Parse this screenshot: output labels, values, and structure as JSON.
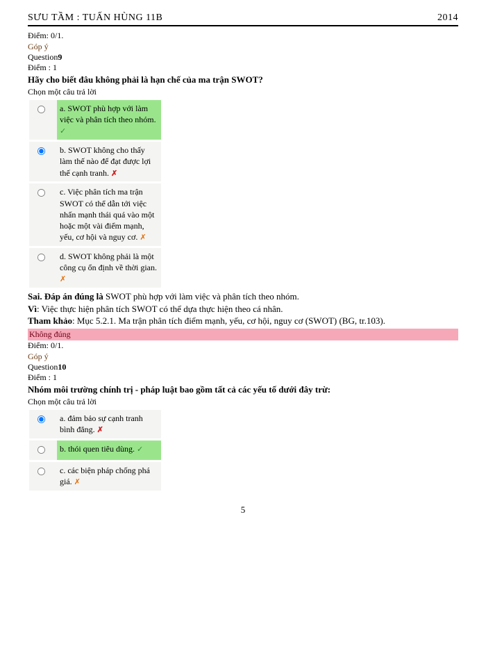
{
  "header": {
    "left": "SƯU TẦM : TUẤN HÙNG 11B",
    "right": "2014"
  },
  "top_score": "Điểm: 0/1.",
  "feedback_label": "Góp ý",
  "q9": {
    "label_prefix": "Question",
    "number": "9",
    "diem": "Điểm : 1",
    "stem": "Hãy cho biết đâu không phải là hạn chế của ma trận SWOT?",
    "choose": "Chọn một câu trả lời",
    "options": [
      {
        "text": "a. SWOT phù hợp với làm việc và phân tích theo nhóm.",
        "correct": true,
        "selected": false,
        "mark": "✓",
        "mark_class": "green"
      },
      {
        "text": "b. SWOT không cho thấy làm thế nào để đạt được lợi thế cạnh tranh.",
        "correct": false,
        "selected": true,
        "mark": "✗",
        "mark_class": "red"
      },
      {
        "text": "c. Việc phân tích ma trận SWOT có thể dẫn tới việc nhấn mạnh thái quá vào một hoặc một vài điểm mạnh, yếu, cơ hội và nguy cơ.",
        "correct": false,
        "selected": false,
        "mark": "✗",
        "mark_class": "orange"
      },
      {
        "text": "d. SWOT không phải là một công cụ ổn định về thời gian.",
        "correct": false,
        "selected": false,
        "mark": "✗",
        "mark_class": "orange"
      }
    ],
    "expl1_b": "Sai. Đáp án đúng là",
    "expl1_r": " SWOT phù hợp với làm việc và phân tích theo nhóm.",
    "expl2_b": "Vì",
    "expl2_r": ": Việc thực hiện phân tích SWOT có thể dựa thực hiện theo cá nhân.",
    "expl3_b": "Tham khảo",
    "expl3_r": ": Mục 5.2.1. Ma trận phân tích điểm mạnh, yếu, cơ hội, nguy cơ (SWOT) (BG, tr.103).",
    "wrong_label": "Không đúng",
    "score": "Điểm: 0/1."
  },
  "q10": {
    "label_prefix": "Question",
    "number": "10",
    "diem": "Điểm : 1",
    "stem": "Nhóm môi trường chính trị - pháp luật bao gồm tất cả các yếu tố dưới đây trừ:",
    "choose": "Chọn một câu trả lời",
    "options": [
      {
        "text": "a. đảm bảo sự cạnh tranh bình đẳng.",
        "correct": false,
        "selected": true,
        "mark": "✗",
        "mark_class": "red"
      },
      {
        "text": "b. thói quen tiêu dùng.",
        "correct": true,
        "selected": false,
        "mark": "✓",
        "mark_class": "green"
      },
      {
        "text": "c. các biện pháp chống phá giá.",
        "correct": false,
        "selected": false,
        "mark": "✗",
        "mark_class": "orange"
      }
    ]
  },
  "page_number": "5"
}
